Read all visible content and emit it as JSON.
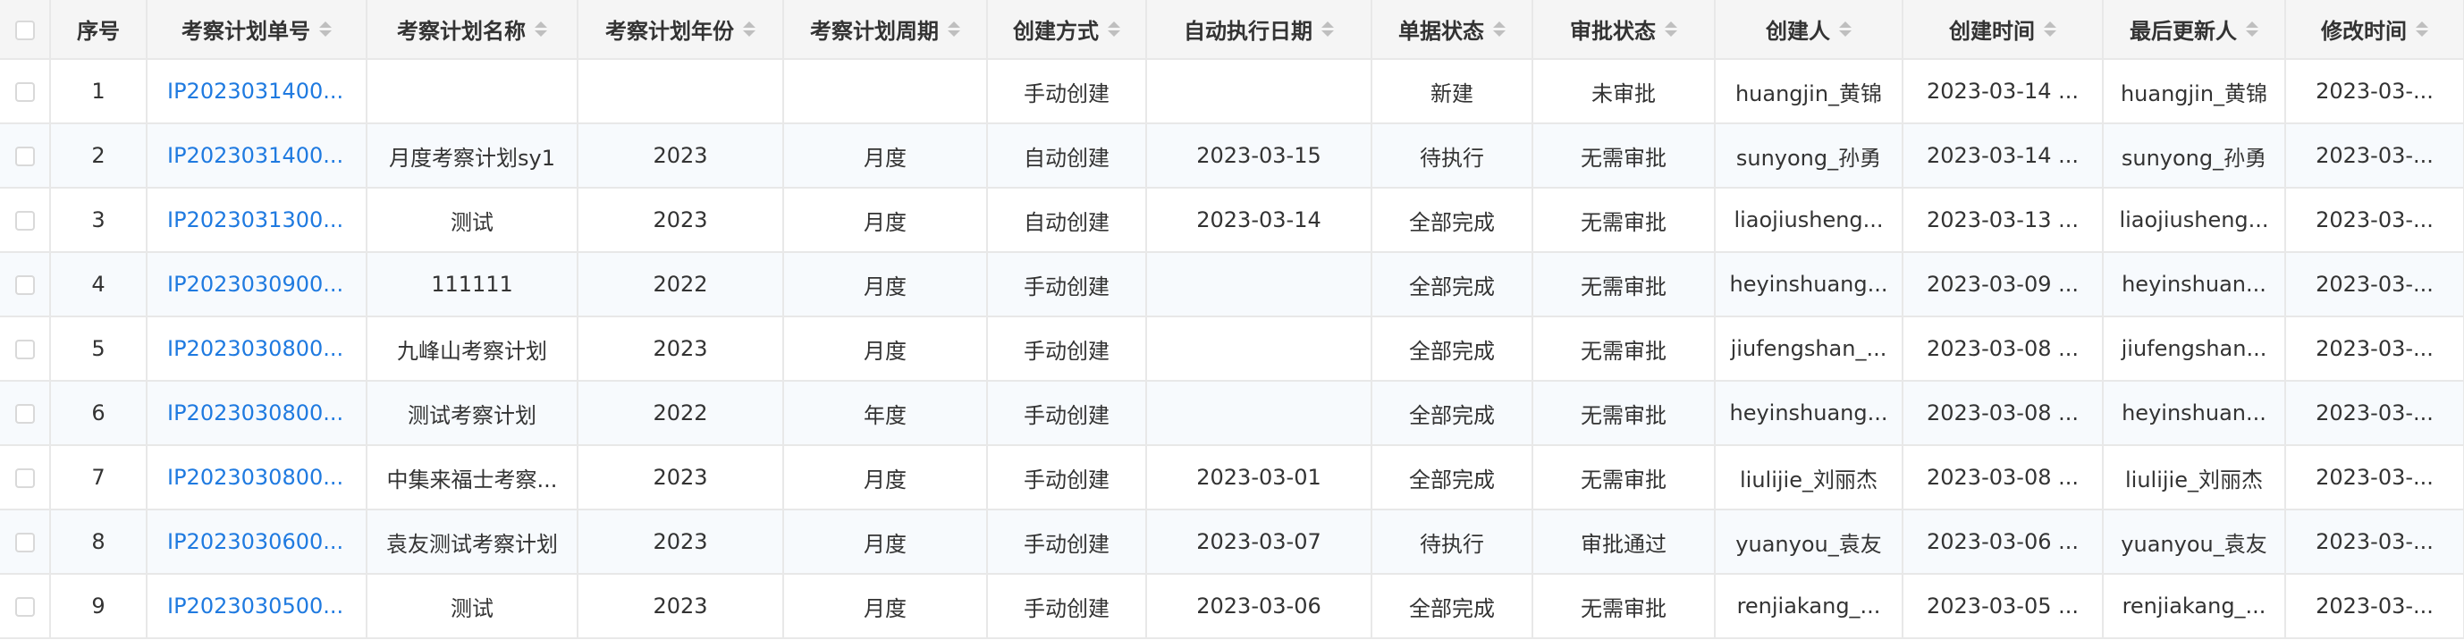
{
  "colors": {
    "header_bg": "#f5f5f5",
    "link": "#1f7ae0",
    "border": "#e8e8e8",
    "stripe": "#f7fafd"
  },
  "table": {
    "columns": [
      {
        "label": "",
        "key": "select"
      },
      {
        "label": "序号",
        "key": "index"
      },
      {
        "label": "考察计划单号",
        "key": "code",
        "sortable": true
      },
      {
        "label": "考察计划名称",
        "key": "name",
        "sortable": true
      },
      {
        "label": "考察计划年份",
        "key": "year",
        "sortable": true
      },
      {
        "label": "考察计划周期",
        "key": "period",
        "sortable": true
      },
      {
        "label": "创建方式",
        "key": "create_mode",
        "sortable": true
      },
      {
        "label": "自动执行日期",
        "key": "auto_date",
        "sortable": true
      },
      {
        "label": "单据状态",
        "key": "doc_status",
        "sortable": true
      },
      {
        "label": "审批状态",
        "key": "approval_status",
        "sortable": true
      },
      {
        "label": "创建人",
        "key": "creator",
        "sortable": true
      },
      {
        "label": "创建时间",
        "key": "created_at",
        "sortable": true
      },
      {
        "label": "最后更新人",
        "key": "updater",
        "sortable": true
      },
      {
        "label": "修改时间",
        "key": "updated_at",
        "sortable": true
      }
    ],
    "rows": [
      {
        "index": "1",
        "code": "IP2023031400...",
        "name": "",
        "year": "",
        "period": "",
        "create_mode": "手动创建",
        "auto_date": "",
        "doc_status": "新建",
        "approval_status": "未审批",
        "creator": "huangjin_黄锦",
        "created_at": "2023-03-14 ...",
        "updater": "huangjin_黄锦",
        "updated_at": "2023-03-..."
      },
      {
        "index": "2",
        "code": "IP2023031400...",
        "name": "月度考察计划sy1",
        "year": "2023",
        "period": "月度",
        "create_mode": "自动创建",
        "auto_date": "2023-03-15",
        "doc_status": "待执行",
        "approval_status": "无需审批",
        "creator": "sunyong_孙勇",
        "created_at": "2023-03-14 ...",
        "updater": "sunyong_孙勇",
        "updated_at": "2023-03-..."
      },
      {
        "index": "3",
        "code": "IP2023031300...",
        "name": "测试",
        "year": "2023",
        "period": "月度",
        "create_mode": "自动创建",
        "auto_date": "2023-03-14",
        "doc_status": "全部完成",
        "approval_status": "无需审批",
        "creator": "liaojiusheng...",
        "created_at": "2023-03-13 ...",
        "updater": "liaojiusheng...",
        "updated_at": "2023-03-..."
      },
      {
        "index": "4",
        "code": "IP2023030900...",
        "name": "111111",
        "year": "2022",
        "period": "月度",
        "create_mode": "手动创建",
        "auto_date": "",
        "doc_status": "全部完成",
        "approval_status": "无需审批",
        "creator": "heyinshuang...",
        "created_at": "2023-03-09 ...",
        "updater": "heyinshuan...",
        "updated_at": "2023-03-..."
      },
      {
        "index": "5",
        "code": "IP2023030800...",
        "name": "九峰山考察计划",
        "year": "2023",
        "period": "月度",
        "create_mode": "手动创建",
        "auto_date": "",
        "doc_status": "全部完成",
        "approval_status": "无需审批",
        "creator": "jiufengshan_...",
        "created_at": "2023-03-08 ...",
        "updater": "jiufengshan...",
        "updated_at": "2023-03-..."
      },
      {
        "index": "6",
        "code": "IP2023030800...",
        "name": "测试考察计划",
        "year": "2022",
        "period": "年度",
        "create_mode": "手动创建",
        "auto_date": "",
        "doc_status": "全部完成",
        "approval_status": "无需审批",
        "creator": "heyinshuang...",
        "created_at": "2023-03-08 ...",
        "updater": "heyinshuan...",
        "updated_at": "2023-03-..."
      },
      {
        "index": "7",
        "code": "IP2023030800...",
        "name": "中集来福士考察...",
        "year": "2023",
        "period": "月度",
        "create_mode": "手动创建",
        "auto_date": "2023-03-01",
        "doc_status": "全部完成",
        "approval_status": "无需审批",
        "creator": "liulijie_刘丽杰",
        "created_at": "2023-03-08 ...",
        "updater": "liulijie_刘丽杰",
        "updated_at": "2023-03-..."
      },
      {
        "index": "8",
        "code": "IP2023030600...",
        "name": "袁友测试考察计划",
        "year": "2023",
        "period": "月度",
        "create_mode": "手动创建",
        "auto_date": "2023-03-07",
        "doc_status": "待执行",
        "approval_status": "审批通过",
        "creator": "yuanyou_袁友",
        "created_at": "2023-03-06 ...",
        "updater": "yuanyou_袁友",
        "updated_at": "2023-03-..."
      },
      {
        "index": "9",
        "code": "IP2023030500...",
        "name": "测试",
        "year": "2023",
        "period": "月度",
        "create_mode": "手动创建",
        "auto_date": "2023-03-06",
        "doc_status": "全部完成",
        "approval_status": "无需审批",
        "creator": "renjiakang_...",
        "created_at": "2023-03-05 ...",
        "updater": "renjiakang_...",
        "updated_at": "2023-03-..."
      }
    ]
  }
}
